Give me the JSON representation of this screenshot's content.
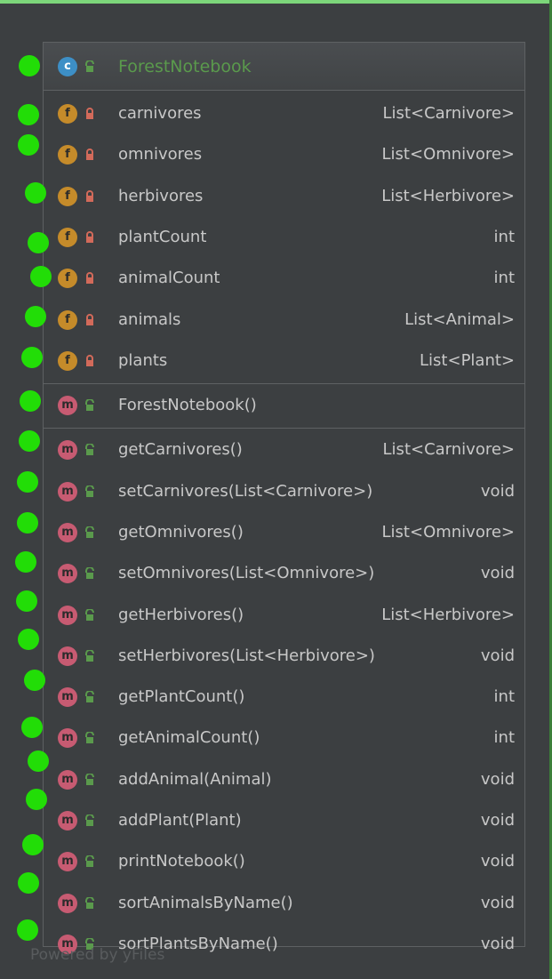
{
  "colors": {
    "background": "#3c3f41",
    "class_icon": "#3d8fc6",
    "field_icon": "#c58b2a",
    "method_icon": "#c75b72",
    "public_lock": "#5a9a4c",
    "private_lock": "#d26a5a",
    "marker_dot": "#22dd07",
    "class_name": "#5a9a4c"
  },
  "class": {
    "icon_letter": "c",
    "name": "ForestNotebook",
    "visibility": "public"
  },
  "fields": [
    {
      "icon_letter": "f",
      "visibility": "private",
      "name": "carnivores",
      "type": "List<Carnivore>"
    },
    {
      "icon_letter": "f",
      "visibility": "private",
      "name": "omnivores",
      "type": "List<Omnivore>"
    },
    {
      "icon_letter": "f",
      "visibility": "private",
      "name": "herbivores",
      "type": "List<Herbivore>"
    },
    {
      "icon_letter": "f",
      "visibility": "private",
      "name": "plantCount",
      "type": "int"
    },
    {
      "icon_letter": "f",
      "visibility": "private",
      "name": "animalCount",
      "type": "int"
    },
    {
      "icon_letter": "f",
      "visibility": "private",
      "name": "animals",
      "type": "List<Animal>"
    },
    {
      "icon_letter": "f",
      "visibility": "private",
      "name": "plants",
      "type": "List<Plant>"
    }
  ],
  "constructors": [
    {
      "icon_letter": "m",
      "visibility": "public",
      "name": "ForestNotebook()",
      "type": ""
    }
  ],
  "methods": [
    {
      "icon_letter": "m",
      "visibility": "public",
      "name": "getCarnivores()",
      "type": "List<Carnivore>"
    },
    {
      "icon_letter": "m",
      "visibility": "public",
      "name": "setCarnivores(List<Carnivore>)",
      "type": "void"
    },
    {
      "icon_letter": "m",
      "visibility": "public",
      "name": "getOmnivores()",
      "type": "List<Omnivore>"
    },
    {
      "icon_letter": "m",
      "visibility": "public",
      "name": "setOmnivores(List<Omnivore>)",
      "type": "void"
    },
    {
      "icon_letter": "m",
      "visibility": "public",
      "name": "getHerbivores()",
      "type": "List<Herbivore>"
    },
    {
      "icon_letter": "m",
      "visibility": "public",
      "name": "setHerbivores(List<Herbivore>)",
      "type": "void"
    },
    {
      "icon_letter": "m",
      "visibility": "public",
      "name": "getPlantCount()",
      "type": "int"
    },
    {
      "icon_letter": "m",
      "visibility": "public",
      "name": "getAnimalCount()",
      "type": "int"
    },
    {
      "icon_letter": "m",
      "visibility": "public",
      "name": "addAnimal(Animal)",
      "type": "void"
    },
    {
      "icon_letter": "m",
      "visibility": "public",
      "name": "addPlant(Plant)",
      "type": "void"
    },
    {
      "icon_letter": "m",
      "visibility": "public",
      "name": "printNotebook()",
      "type": "void"
    },
    {
      "icon_letter": "m",
      "visibility": "public",
      "name": "sortAnimalsByName()",
      "type": "void"
    },
    {
      "icon_letter": "m",
      "visibility": "public",
      "name": "sortPlantsByName()",
      "type": "void"
    }
  ],
  "footer": "Powered by yFiles"
}
